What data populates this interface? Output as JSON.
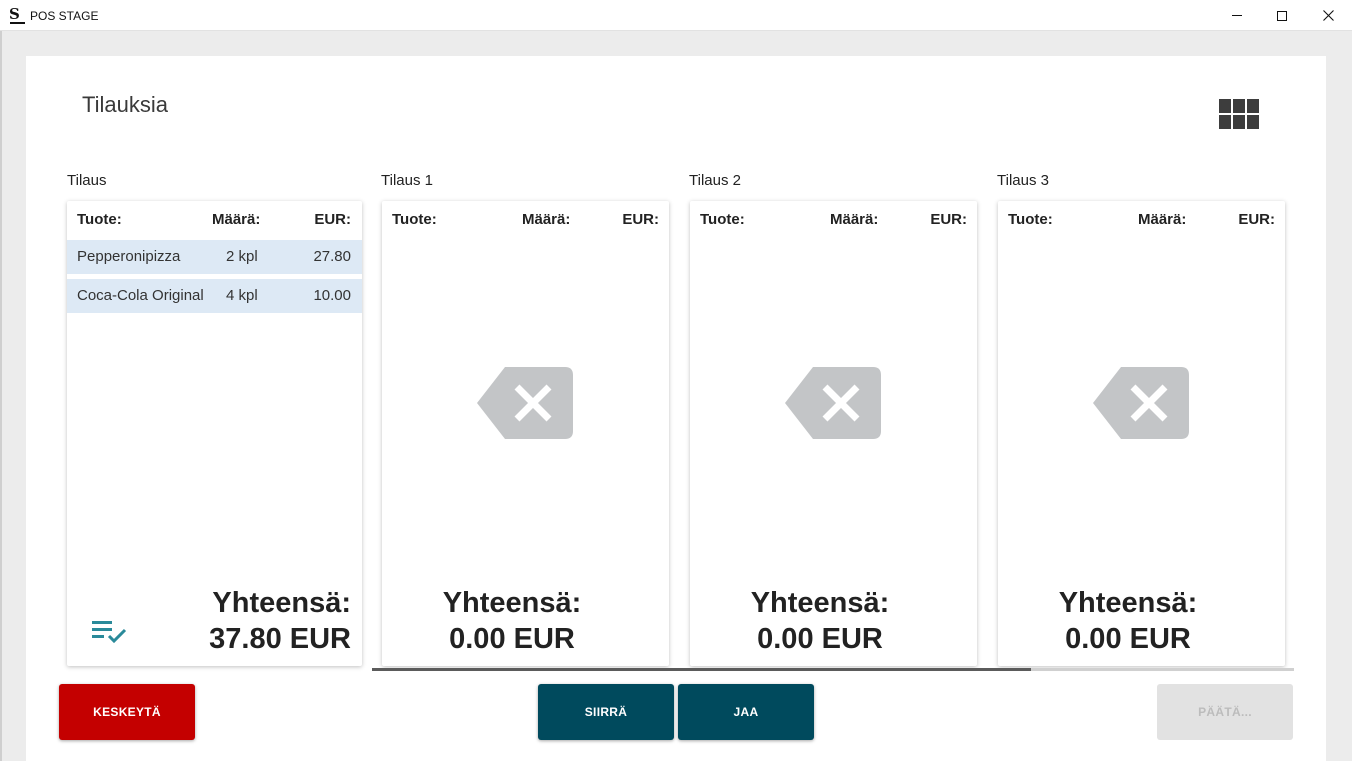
{
  "window": {
    "title": "POS STAGE",
    "logo_letter": "S"
  },
  "page": {
    "title": "Tilauksia"
  },
  "columns": {
    "product": "Tuote:",
    "quantity": "Määrä:",
    "currency": "EUR:"
  },
  "orders": [
    {
      "label": "Tilaus",
      "items": [
        {
          "product": "Pepperonipizza",
          "quantity": "2 kpl",
          "price": "27.80"
        },
        {
          "product": "Coca-Cola Original",
          "quantity": "4 kpl",
          "price": "10.00"
        }
      ],
      "total_label": "Yhteensä:",
      "total_value": "37.80 EUR"
    },
    {
      "label": "Tilaus 1",
      "items": [],
      "total_label": "Yhteensä:",
      "total_value": "0.00 EUR"
    },
    {
      "label": "Tilaus 2",
      "items": [],
      "total_label": "Yhteensä:",
      "total_value": "0.00 EUR"
    },
    {
      "label": "Tilaus 3",
      "items": [],
      "total_label": "Yhteensä:",
      "total_value": "0.00 EUR"
    }
  ],
  "buttons": {
    "cancel": "KESKEYTÄ",
    "move": "SIIRRÄ",
    "split": "JAA",
    "finish": "PÄÄTÄ..."
  },
  "colors": {
    "cancel": "#c40000",
    "primary": "#004a5d",
    "disabled": "#e2e2e2",
    "row_highlight": "#dde9f5",
    "accent_icon": "#2a8a9a"
  },
  "icons": {
    "grid": "grid-view-icon",
    "empty": "backspace-x-icon",
    "done": "playlist-check-icon"
  }
}
